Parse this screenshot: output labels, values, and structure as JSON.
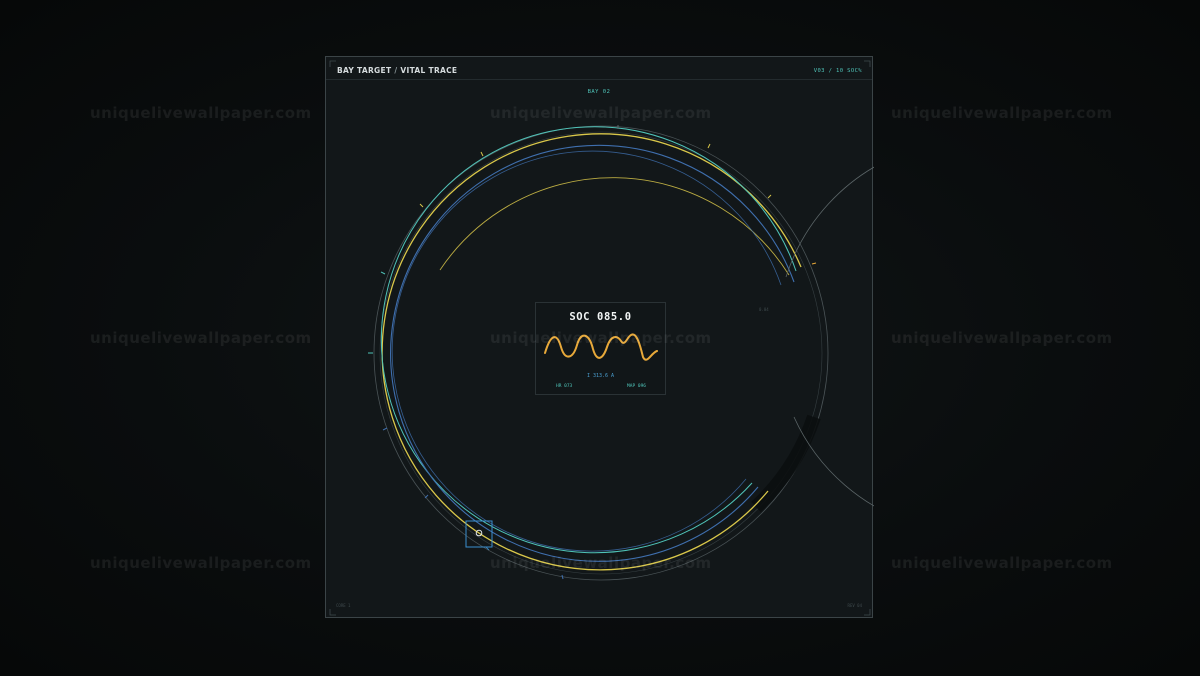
{
  "header": {
    "title_left": "BAY TARGET",
    "title_sep": "/",
    "title_right": "VITAL TRACE",
    "status": "V03 / 10  SOC%"
  },
  "bay_label": "BAY 02",
  "side_label": "0.04",
  "corner_left": "CORE 1",
  "corner_right": "REV 04",
  "readout": {
    "soc": "SOC 085.0",
    "current": "I 313.6 A",
    "hr": "HR 073",
    "map": "MAP 096"
  },
  "soc_value": 85.0,
  "watermark": "uniquelivewallpaper.com",
  "colors": {
    "yellow": "#d9c74a",
    "teal": "#4fc3b8",
    "blue": "#3f6fae",
    "grey": "#5c6668",
    "wave": "#e8a93a",
    "target": "#3a8fd0"
  }
}
